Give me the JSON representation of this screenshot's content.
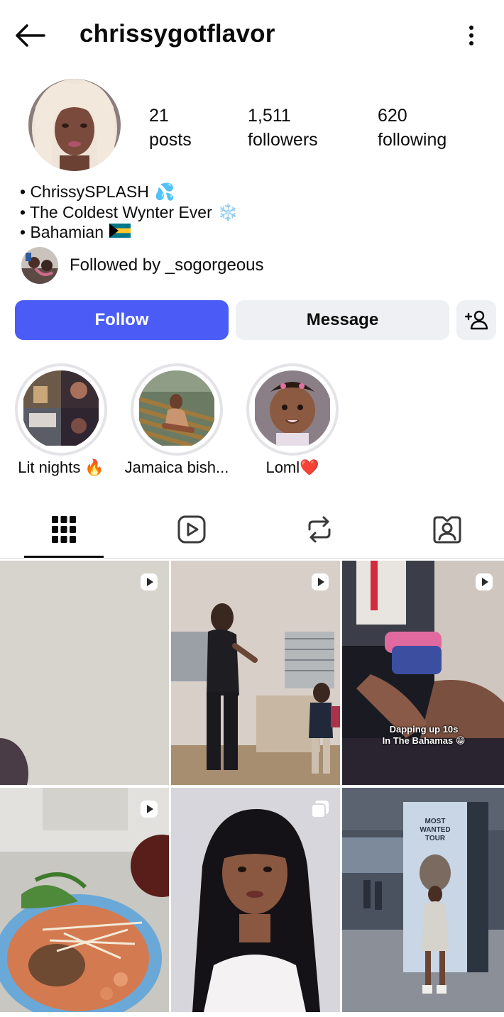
{
  "header": {
    "username": "chrissygotflavor",
    "back_icon": "arrow-left-icon",
    "more_icon": "vertical-dots-icon"
  },
  "stats": {
    "posts": {
      "value": "21",
      "label": "posts"
    },
    "followers": {
      "value": "1,511",
      "label": "followers"
    },
    "following": {
      "value": "620",
      "label": "following"
    }
  },
  "bio": [
    {
      "text": "• ChrissySPLASH",
      "emoji": "💦"
    },
    {
      "text": "• The Coldest Wynter Ever",
      "emoji": "❄️"
    },
    {
      "text": "• Bahamian",
      "emoji": "🇧🇸"
    }
  ],
  "followed_by": {
    "prefix": "Followed by ",
    "user": "_sogorgeous"
  },
  "actions": {
    "follow": "Follow",
    "message": "Message",
    "add_user_icon": "add-person-icon"
  },
  "highlights": [
    {
      "label": "Lit nights",
      "emoji": "🔥"
    },
    {
      "label": "Jamaica bish...",
      "emoji": ""
    },
    {
      "label": "Loml",
      "emoji": "❤️"
    }
  ],
  "tabs": [
    {
      "name": "grid",
      "icon": "grid-icon",
      "active": true
    },
    {
      "name": "reels",
      "icon": "reels-icon",
      "active": false
    },
    {
      "name": "reposts",
      "icon": "repost-icon",
      "active": false
    },
    {
      "name": "tagged",
      "icon": "tagged-person-icon",
      "active": false
    }
  ],
  "posts": [
    {
      "type": "reel",
      "caption": ""
    },
    {
      "type": "reel",
      "caption": ""
    },
    {
      "type": "reel",
      "caption": "Dapping up 10s\nIn The Bahamas 😁"
    },
    {
      "type": "reel",
      "caption": ""
    },
    {
      "type": "carousel",
      "caption": ""
    },
    {
      "type": "photo",
      "caption": ""
    }
  ],
  "colors": {
    "follow_button": "#4a5cf5",
    "secondary_button": "#eff0f3",
    "text": "#0b0b0b"
  }
}
